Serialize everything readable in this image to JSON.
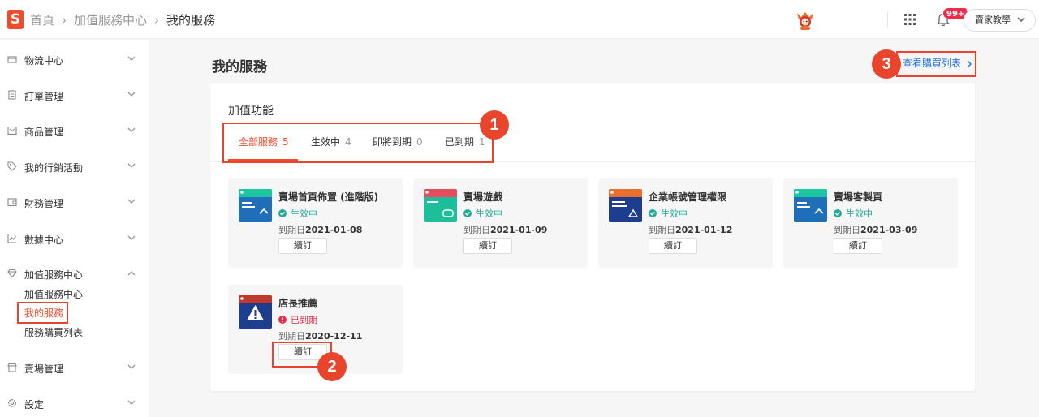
{
  "header": {
    "logo_letter": "S",
    "breadcrumb": [
      "首頁",
      "加值服務中心",
      "我的服務"
    ],
    "breadcrumb_sep": "›",
    "notification_badge": "99+",
    "account_label": "賣家教學"
  },
  "sidebar": {
    "sections": [
      {
        "label": "物流中心",
        "icon": "truck-icon"
      },
      {
        "label": "訂單管理",
        "icon": "clipboard-icon"
      },
      {
        "label": "商品管理",
        "icon": "box-icon"
      },
      {
        "label": "我的行銷活動",
        "icon": "tag-icon"
      },
      {
        "label": "財務管理",
        "icon": "wallet-icon"
      },
      {
        "label": "數據中心",
        "icon": "chart-icon"
      },
      {
        "label": "加值服務中心",
        "icon": "diamond-icon"
      },
      {
        "label": "賣場管理",
        "icon": "shop-icon"
      },
      {
        "label": "設定",
        "icon": "gear-icon"
      }
    ],
    "subitems": [
      "加值服務中心",
      "我的服務",
      "服務購買列表"
    ]
  },
  "main": {
    "title": "我的服務",
    "view_purchase_link": "查看購買列表",
    "panel_title": "加值功能",
    "tabs": [
      {
        "label": "全部服務",
        "count": "5"
      },
      {
        "label": "生效中",
        "count": "4"
      },
      {
        "label": "即將到期",
        "count": "0"
      },
      {
        "label": "已到期",
        "count": "1"
      }
    ],
    "due_label": "到期日",
    "renew_label": "續訂",
    "cards": [
      {
        "name": "賣場首頁佈置 (進階版)",
        "status": "生效中",
        "status_color": "#26aa99",
        "date": "2021-01-08",
        "thumb_bg": "#1f6fb8",
        "thumb_top": "#1cc6a0"
      },
      {
        "name": "賣場遊戲",
        "status": "生效中",
        "status_color": "#26aa99",
        "date": "2021-01-09",
        "thumb_bg": "#1cbf9a",
        "thumb_top": "#e84b5c"
      },
      {
        "name": "企業帳號管理權限",
        "status": "生效中",
        "status_color": "#26aa99",
        "date": "2021-01-12",
        "thumb_bg": "#1d3d8f",
        "thumb_top": "#e8702c"
      },
      {
        "name": "賣場客製頁",
        "status": "生效中",
        "status_color": "#26aa99",
        "date": "2021-03-09",
        "thumb_bg": "#1f6fb8",
        "thumb_top": "#1cc6a0"
      },
      {
        "name": "店長推薦",
        "status": "已到期",
        "status_color": "#ee2c4a",
        "date": "2020-12-11",
        "thumb_bg": "#1d3d8f",
        "thumb_top": "#c0392b"
      }
    ]
  },
  "annotations": [
    "1",
    "2",
    "3"
  ],
  "colors": {
    "brand": "#ee4d2d",
    "link": "#2673dd",
    "annotation": "#e8452c"
  }
}
